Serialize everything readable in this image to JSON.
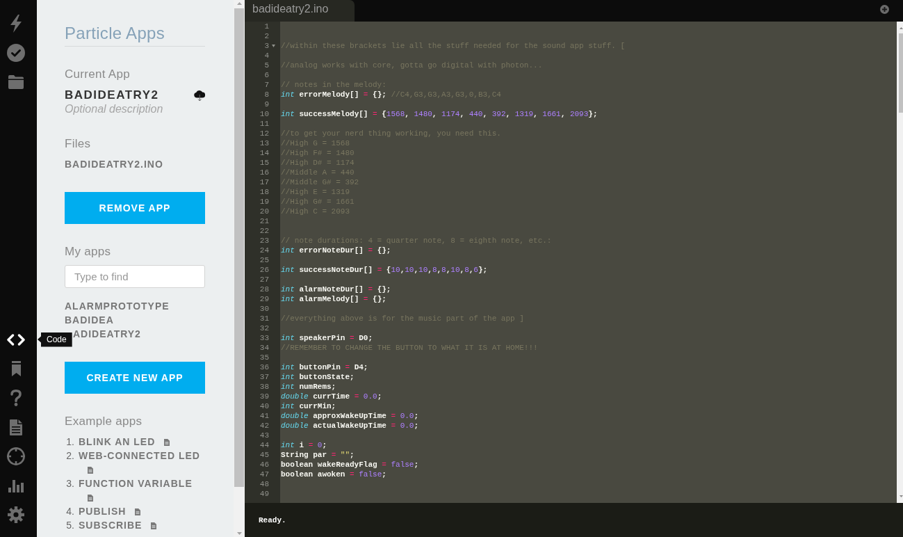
{
  "nav": {
    "top": [
      {
        "selected": false
      },
      {
        "selected": false
      },
      {
        "selected": false
      }
    ],
    "bottom": [
      {
        "selected": true,
        "tooltip": "Code"
      },
      {
        "selected": false
      },
      {
        "selected": false
      },
      {
        "selected": false
      },
      {
        "selected": false
      },
      {
        "selected": false
      },
      {
        "selected": false
      }
    ]
  },
  "panel": {
    "title": "Particle Apps",
    "current_app": {
      "label": "Current App",
      "name": "BADIDEATRY2",
      "description": {
        "placeholder": "Optional description"
      }
    },
    "files": {
      "label": "Files",
      "items": [
        "BADIDEATRY2.INO"
      ]
    },
    "remove_button": "REMOVE APP",
    "my_apps": {
      "label": "My apps",
      "search": {
        "placeholder": "Type to find"
      },
      "items": [
        {
          "name": "ALARMPROTOTYPE"
        },
        {
          "name": "BADIDEA"
        },
        {
          "name": "ADIDEATRY2",
          "under_tooltip": true
        }
      ]
    },
    "create_button": "CREATE NEW APP",
    "examples": {
      "label": "Example apps",
      "items": [
        {
          "number": "1.",
          "name": "BLINK AN LED"
        },
        {
          "number": "2.",
          "name": "WEB-CONNECTED LED"
        },
        {
          "number": "3.",
          "name": "FUNCTION VARIABLE"
        },
        {
          "number": "4.",
          "name": "PUBLISH"
        },
        {
          "number": "5.",
          "name": "SUBSCRIBE"
        }
      ]
    }
  },
  "editor": {
    "tabs": [
      {
        "label": "badideatry2.ino",
        "selected": true
      }
    ],
    "lines": [
      {
        "number": "1",
        "foldable": false
      },
      {
        "number": "2",
        "foldable": false
      },
      {
        "number": "3",
        "foldable": true,
        "tokens": [
          {
            "kind": "comment",
            "text": "//within these brackets lie all the stuff needed for the sound app stuff. ["
          }
        ]
      },
      {
        "number": "4",
        "foldable": false
      },
      {
        "number": "5",
        "foldable": false,
        "tokens": [
          {
            "kind": "comment",
            "text": "//analog works with core, gotta go digital with photon..."
          }
        ]
      },
      {
        "number": "6",
        "foldable": false
      },
      {
        "number": "7",
        "foldable": false,
        "tokens": [
          {
            "kind": "comment",
            "text": "// notes in the melody:"
          }
        ]
      },
      {
        "number": "8",
        "foldable": false,
        "tokens": [
          {
            "kind": "keyword",
            "text": "int"
          },
          {
            "kind": "plain",
            "text": " errorMelody[] "
          },
          {
            "kind": "operator",
            "text": "="
          },
          {
            "kind": "plain",
            "text": " {}; "
          },
          {
            "kind": "comment",
            "text": "//C4,G3,G3,A3,G3,0,B3,C4"
          }
        ]
      },
      {
        "number": "9",
        "foldable": false
      },
      {
        "number": "10",
        "foldable": false,
        "tokens": [
          {
            "kind": "keyword",
            "text": "int"
          },
          {
            "kind": "plain",
            "text": " successMelody[] "
          },
          {
            "kind": "operator",
            "text": "="
          },
          {
            "kind": "plain",
            "text": " {"
          },
          {
            "kind": "number",
            "text": "1568"
          },
          {
            "kind": "plain",
            "text": ", "
          },
          {
            "kind": "number",
            "text": "1480"
          },
          {
            "kind": "plain",
            "text": ", "
          },
          {
            "kind": "number",
            "text": "1174"
          },
          {
            "kind": "plain",
            "text": ", "
          },
          {
            "kind": "number",
            "text": "440"
          },
          {
            "kind": "plain",
            "text": ", "
          },
          {
            "kind": "number",
            "text": "392"
          },
          {
            "kind": "plain",
            "text": ", "
          },
          {
            "kind": "number",
            "text": "1319"
          },
          {
            "kind": "plain",
            "text": ", "
          },
          {
            "kind": "number",
            "text": "1661"
          },
          {
            "kind": "plain",
            "text": ", "
          },
          {
            "kind": "number",
            "text": "2093"
          },
          {
            "kind": "plain",
            "text": "};"
          }
        ]
      },
      {
        "number": "11",
        "foldable": false
      },
      {
        "number": "12",
        "foldable": false,
        "tokens": [
          {
            "kind": "comment",
            "text": "//to get your nerd thing working, you need this."
          }
        ]
      },
      {
        "number": "13",
        "foldable": false,
        "tokens": [
          {
            "kind": "comment",
            "text": "//High G = 1568"
          }
        ]
      },
      {
        "number": "14",
        "foldable": false,
        "tokens": [
          {
            "kind": "comment",
            "text": "//High F# = 1480"
          }
        ]
      },
      {
        "number": "15",
        "foldable": false,
        "tokens": [
          {
            "kind": "comment",
            "text": "//High D# = 1174"
          }
        ]
      },
      {
        "number": "16",
        "foldable": false,
        "tokens": [
          {
            "kind": "comment",
            "text": "//Middle A = 440"
          }
        ]
      },
      {
        "number": "17",
        "foldable": false,
        "tokens": [
          {
            "kind": "comment",
            "text": "//Middle G# = 392"
          }
        ]
      },
      {
        "number": "18",
        "foldable": false,
        "tokens": [
          {
            "kind": "comment",
            "text": "//High E = 1319"
          }
        ]
      },
      {
        "number": "19",
        "foldable": false,
        "tokens": [
          {
            "kind": "comment",
            "text": "//High G# = 1661"
          }
        ]
      },
      {
        "number": "20",
        "foldable": false,
        "tokens": [
          {
            "kind": "comment",
            "text": "//High C = 2093"
          }
        ]
      },
      {
        "number": "21",
        "foldable": false
      },
      {
        "number": "22",
        "foldable": false
      },
      {
        "number": "23",
        "foldable": false,
        "tokens": [
          {
            "kind": "comment",
            "text": "// note durations: 4 = quarter note, 8 = eighth note, etc.:"
          }
        ]
      },
      {
        "number": "24",
        "foldable": false,
        "tokens": [
          {
            "kind": "keyword",
            "text": "int"
          },
          {
            "kind": "plain",
            "text": " errorNoteDur[] "
          },
          {
            "kind": "operator",
            "text": "="
          },
          {
            "kind": "plain",
            "text": " {};"
          }
        ]
      },
      {
        "number": "25",
        "foldable": false
      },
      {
        "number": "26",
        "foldable": false,
        "tokens": [
          {
            "kind": "keyword",
            "text": "int"
          },
          {
            "kind": "plain",
            "text": " successNoteDur[] "
          },
          {
            "kind": "operator",
            "text": "="
          },
          {
            "kind": "plain",
            "text": " {"
          },
          {
            "kind": "number",
            "text": "10"
          },
          {
            "kind": "plain",
            "text": ","
          },
          {
            "kind": "number",
            "text": "10"
          },
          {
            "kind": "plain",
            "text": ","
          },
          {
            "kind": "number",
            "text": "10"
          },
          {
            "kind": "plain",
            "text": ","
          },
          {
            "kind": "number",
            "text": "8"
          },
          {
            "kind": "plain",
            "text": ","
          },
          {
            "kind": "number",
            "text": "8"
          },
          {
            "kind": "plain",
            "text": ","
          },
          {
            "kind": "number",
            "text": "10"
          },
          {
            "kind": "plain",
            "text": ","
          },
          {
            "kind": "number",
            "text": "8"
          },
          {
            "kind": "plain",
            "text": ","
          },
          {
            "kind": "number",
            "text": "6"
          },
          {
            "kind": "plain",
            "text": "};"
          }
        ]
      },
      {
        "number": "27",
        "foldable": false
      },
      {
        "number": "28",
        "foldable": false,
        "tokens": [
          {
            "kind": "keyword",
            "text": "int"
          },
          {
            "kind": "plain",
            "text": " alarmNoteDur[] "
          },
          {
            "kind": "operator",
            "text": "="
          },
          {
            "kind": "plain",
            "text": " {};"
          }
        ]
      },
      {
        "number": "29",
        "foldable": false,
        "tokens": [
          {
            "kind": "keyword",
            "text": "int"
          },
          {
            "kind": "plain",
            "text": " alarmMelody[] "
          },
          {
            "kind": "operator",
            "text": "="
          },
          {
            "kind": "plain",
            "text": " {};"
          }
        ]
      },
      {
        "number": "30",
        "foldable": false
      },
      {
        "number": "31",
        "foldable": false,
        "tokens": [
          {
            "kind": "comment",
            "text": "//everything above is for the music part of the app ]"
          }
        ]
      },
      {
        "number": "32",
        "foldable": false
      },
      {
        "number": "33",
        "foldable": false,
        "tokens": [
          {
            "kind": "keyword",
            "text": "int"
          },
          {
            "kind": "plain",
            "text": " speakerPin "
          },
          {
            "kind": "operator",
            "text": "="
          },
          {
            "kind": "plain",
            "text": " D0;"
          }
        ]
      },
      {
        "number": "34",
        "foldable": false,
        "tokens": [
          {
            "kind": "comment",
            "text": "//REMEMBER TO CHANGE THE BUTTON TO WHAT IT IS AT HOME!!!"
          }
        ]
      },
      {
        "number": "35",
        "foldable": false
      },
      {
        "number": "36",
        "foldable": false,
        "tokens": [
          {
            "kind": "keyword",
            "text": "int"
          },
          {
            "kind": "plain",
            "text": " buttonPin "
          },
          {
            "kind": "operator",
            "text": "="
          },
          {
            "kind": "plain",
            "text": " D4;"
          }
        ]
      },
      {
        "number": "37",
        "foldable": false,
        "tokens": [
          {
            "kind": "keyword",
            "text": "int"
          },
          {
            "kind": "plain",
            "text": " buttonState;"
          }
        ]
      },
      {
        "number": "38",
        "foldable": false,
        "tokens": [
          {
            "kind": "keyword",
            "text": "int"
          },
          {
            "kind": "plain",
            "text": " numRems;"
          }
        ]
      },
      {
        "number": "39",
        "foldable": false,
        "tokens": [
          {
            "kind": "keyword",
            "text": "double"
          },
          {
            "kind": "plain",
            "text": " currTime "
          },
          {
            "kind": "operator",
            "text": "= "
          },
          {
            "kind": "number",
            "text": "0.0"
          },
          {
            "kind": "plain",
            "text": ";"
          }
        ]
      },
      {
        "number": "40",
        "foldable": false,
        "tokens": [
          {
            "kind": "keyword",
            "text": "int"
          },
          {
            "kind": "plain",
            "text": " currMin;"
          }
        ]
      },
      {
        "number": "41",
        "foldable": false,
        "tokens": [
          {
            "kind": "keyword",
            "text": "double"
          },
          {
            "kind": "plain",
            "text": " approxWakeUpTime "
          },
          {
            "kind": "operator",
            "text": "= "
          },
          {
            "kind": "number",
            "text": "0.0"
          },
          {
            "kind": "plain",
            "text": ";"
          }
        ]
      },
      {
        "number": "42",
        "foldable": false,
        "tokens": [
          {
            "kind": "keyword",
            "text": "double"
          },
          {
            "kind": "plain",
            "text": " actualWakeUpTime "
          },
          {
            "kind": "operator",
            "text": "= "
          },
          {
            "kind": "number",
            "text": "0.0"
          },
          {
            "kind": "plain",
            "text": ";"
          }
        ]
      },
      {
        "number": "43",
        "foldable": false
      },
      {
        "number": "44",
        "foldable": false,
        "tokens": [
          {
            "kind": "keyword",
            "text": "int"
          },
          {
            "kind": "plain",
            "text": " i "
          },
          {
            "kind": "operator",
            "text": "= "
          },
          {
            "kind": "number",
            "text": "0"
          },
          {
            "kind": "plain",
            "text": ";"
          }
        ]
      },
      {
        "number": "45",
        "foldable": false,
        "tokens": [
          {
            "kind": "plain",
            "text": "String par "
          },
          {
            "kind": "operator",
            "text": "= "
          },
          {
            "kind": "string",
            "text": "\"\""
          },
          {
            "kind": "plain",
            "text": ";"
          }
        ]
      },
      {
        "number": "46",
        "foldable": false,
        "tokens": [
          {
            "kind": "plain",
            "text": "boolean wakeReadyFlag "
          },
          {
            "kind": "operator",
            "text": "= "
          },
          {
            "kind": "constant",
            "text": "false"
          },
          {
            "kind": "plain",
            "text": ";"
          }
        ]
      },
      {
        "number": "47",
        "foldable": false,
        "tokens": [
          {
            "kind": "plain",
            "text": "boolean awoken "
          },
          {
            "kind": "operator",
            "text": "= "
          },
          {
            "kind": "constant",
            "text": "false"
          },
          {
            "kind": "plain",
            "text": ";"
          }
        ]
      },
      {
        "number": "48",
        "foldable": false
      },
      {
        "number": "49",
        "foldable": false
      }
    ],
    "status": "Ready."
  }
}
